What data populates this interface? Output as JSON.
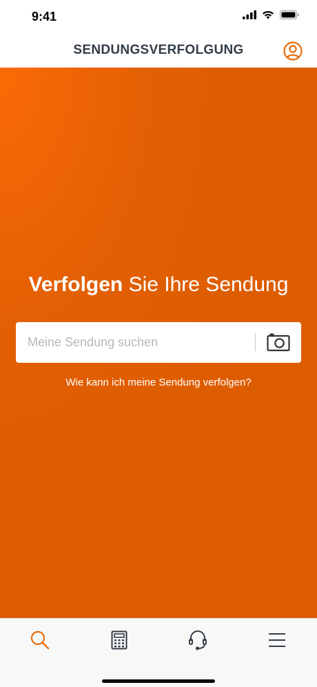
{
  "status_bar": {
    "time": "9:41"
  },
  "header": {
    "title": "SENDUNGSVERFOLGUNG"
  },
  "hero": {
    "headline_strong": "Verfolgen",
    "headline_rest": " Sie Ihre Sendung",
    "search_placeholder": "Meine Sendung suchen",
    "search_value": "",
    "help_link": "Wie kann ich meine Sendung verfolgen?"
  },
  "colors": {
    "brand_orange": "#dd5c00",
    "header_text": "#333d47",
    "tab_active": "#e86c0a",
    "tab_inactive": "#333d47"
  },
  "tabs": [
    {
      "icon": "search-icon",
      "active": true
    },
    {
      "icon": "calculator-icon",
      "active": false
    },
    {
      "icon": "headset-icon",
      "active": false
    },
    {
      "icon": "menu-icon",
      "active": false
    }
  ]
}
